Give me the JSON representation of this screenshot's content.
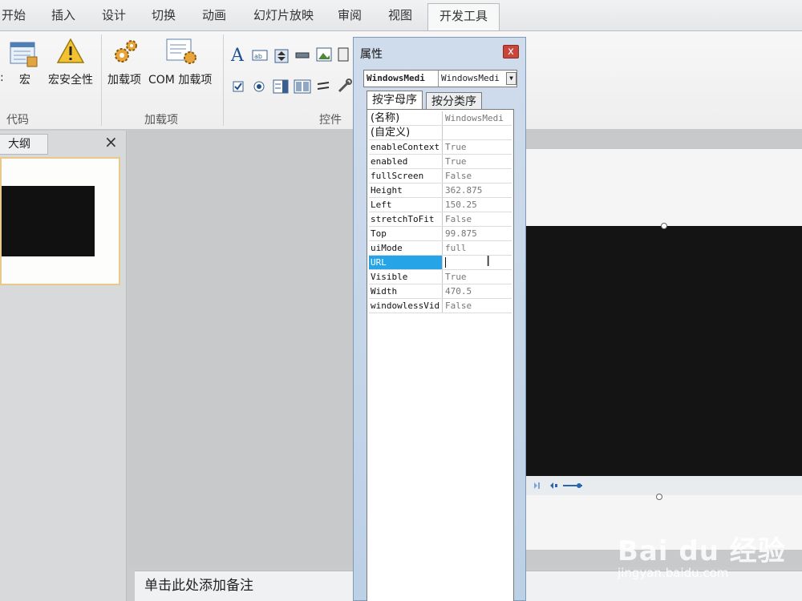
{
  "ribbon_tabs": [
    "开始",
    "插入",
    "设计",
    "切换",
    "动画",
    "幻灯片放映",
    "审阅",
    "视图",
    "开发工具"
  ],
  "active_tab": "开发工具",
  "ribbon": {
    "code_group": {
      "label": "代码",
      "macro": "宏",
      "macro_security": "宏安全性"
    },
    "addins_group": {
      "label": "加载项",
      "addins": "加载项",
      "com_addins": "COM 加载项"
    },
    "controls_group": {
      "label": "控件"
    }
  },
  "left_pane": {
    "tab": "大纲",
    "close": "×"
  },
  "notes_placeholder": "单击此处添加备注",
  "properties": {
    "title": "属性",
    "close": "x",
    "object_name": "WindowsMedi",
    "object_type": "WindowsMedi",
    "tabs": [
      "按字母序",
      "按分类序"
    ],
    "rows": [
      {
        "name": "(名称)",
        "value": "WindowsMedi"
      },
      {
        "name": "(自定义)",
        "value": ""
      },
      {
        "name": "enableContext",
        "value": "True"
      },
      {
        "name": "enabled",
        "value": "True"
      },
      {
        "name": "fullScreen",
        "value": "False"
      },
      {
        "name": "Height",
        "value": "362.875"
      },
      {
        "name": "Left",
        "value": "150.25"
      },
      {
        "name": "stretchToFit",
        "value": "False"
      },
      {
        "name": "Top",
        "value": "99.875"
      },
      {
        "name": "uiMode",
        "value": "full"
      },
      {
        "name": "URL",
        "value": ""
      },
      {
        "name": "Visible",
        "value": "True"
      },
      {
        "name": "Width",
        "value": "470.5"
      },
      {
        "name": "windowlessVid",
        "value": "False"
      }
    ],
    "selected_row": "URL"
  },
  "watermark": {
    "brand": "Bai du 经验",
    "url": "jingyan.baidu.com"
  },
  "colors": {
    "selection": "#26a4e8",
    "close_button": "#c9473a",
    "window_frame": "#bcd0e6"
  }
}
